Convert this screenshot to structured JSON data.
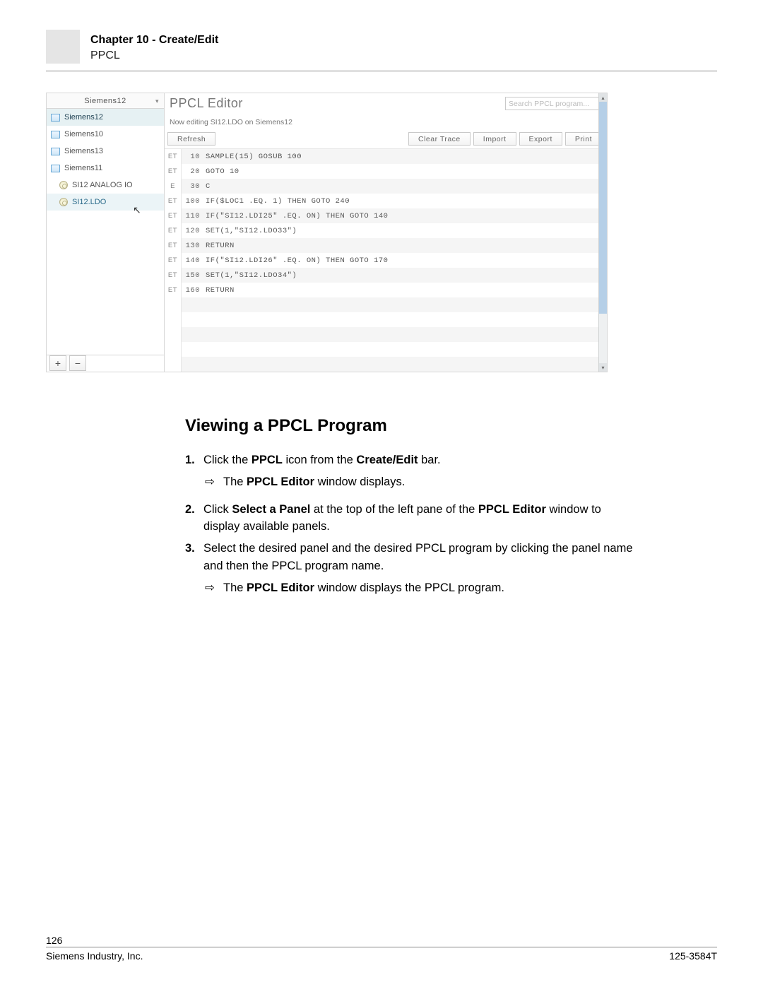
{
  "header": {
    "chapter": "Chapter 10 - Create/Edit",
    "sub": "PPCL"
  },
  "app": {
    "panel_selector": "Siemens12",
    "search_placeholder": "Search PPCL program...",
    "editor_title": "PPCL Editor",
    "subtitle": "Now editing  SI12.LDO on Siemens12",
    "toolbar": {
      "refresh": "Refresh",
      "clear_trace": "Clear Trace",
      "import": "Import",
      "export": "Export",
      "print": "Print"
    },
    "tree": [
      {
        "label": "Siemens12",
        "type": "panel",
        "state": "active"
      },
      {
        "label": "Siemens10",
        "type": "panel",
        "state": ""
      },
      {
        "label": "Siemens13",
        "type": "panel",
        "state": ""
      },
      {
        "label": "Siemens11",
        "type": "panel",
        "state": ""
      },
      {
        "label": "SI12 ANALOG IO",
        "type": "prog",
        "state": ""
      },
      {
        "label": "SI12.LDO",
        "type": "prog",
        "state": "selected"
      }
    ],
    "add_btn": "+",
    "remove_btn": "−",
    "code": [
      {
        "status": "ET",
        "num": "10",
        "text": "SAMPLE(15) GOSUB 100"
      },
      {
        "status": "ET",
        "num": "20",
        "text": "GOTO 10"
      },
      {
        "status": "E",
        "num": "30",
        "text": "C"
      },
      {
        "status": "ET",
        "num": "100",
        "text": "IF($LOC1 .EQ. 1) THEN GOTO 240"
      },
      {
        "status": "ET",
        "num": "110",
        "text": "IF(\"SI12.LDI25\" .EQ. ON) THEN GOTO 140"
      },
      {
        "status": "ET",
        "num": "120",
        "text": "SET(1,\"SI12.LDO33\")"
      },
      {
        "status": "ET",
        "num": "130",
        "text": "RETURN"
      },
      {
        "status": "ET",
        "num": "140",
        "text": "IF(\"SI12.LDI26\" .EQ. ON) THEN GOTO 170"
      },
      {
        "status": "ET",
        "num": "150",
        "text": "SET(1,\"SI12.LDO34\")"
      },
      {
        "status": "ET",
        "num": "160",
        "text": "RETURN"
      },
      {
        "status": "",
        "num": "",
        "text": ""
      },
      {
        "status": "",
        "num": "",
        "text": ""
      },
      {
        "status": "",
        "num": "",
        "text": ""
      },
      {
        "status": "",
        "num": "",
        "text": ""
      },
      {
        "status": "",
        "num": "",
        "text": ""
      }
    ]
  },
  "body": {
    "heading": "Viewing a PPCL Program",
    "step1_a": "Click the ",
    "step1_b": "PPCL",
    "step1_c": " icon from the ",
    "step1_d": "Create/Edit",
    "step1_e": " bar.",
    "sub1_a": "The ",
    "sub1_b": "PPCL Editor",
    "sub1_c": " window displays.",
    "step2_a": "Click ",
    "step2_b": "Select a Panel",
    "step2_c": " at the top of the left pane of the ",
    "step2_d": "PPCL Editor",
    "step2_e": " window to display available panels.",
    "step3": "Select the desired panel and the desired PPCL program by clicking the panel name and then the PPCL program name.",
    "sub3_a": "The ",
    "sub3_b": "PPCL Editor",
    "sub3_c": " window displays the PPCL program.",
    "n1": "1.",
    "n2": "2.",
    "n3": "3.",
    "arrow": "⇨"
  },
  "footer": {
    "page": "126",
    "left": "Siemens Industry, Inc.",
    "right": "125-3584T"
  }
}
